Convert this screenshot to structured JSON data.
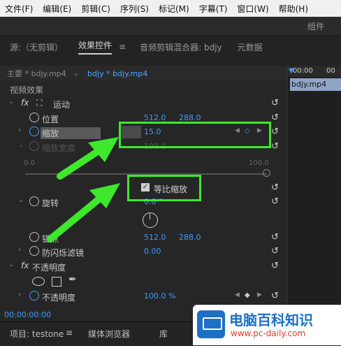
{
  "menu": [
    "文件(F)",
    "编辑(E)",
    "剪辑(C)",
    "序列(S)",
    "标记(M)",
    "字幕(T)",
    "窗口(W)",
    "帮助(H)"
  ],
  "workspace_label": "组件",
  "panel_tabs": {
    "source": "源:（无剪辑）",
    "effect_controls": "效果控件",
    "audio_mixer": "音频剪辑混合器: bdjy",
    "metadata": "元数据"
  },
  "source_bar": {
    "main": "主要 * bdjy.mp4",
    "sequence": "bdjy * bdjy.mp4"
  },
  "timeline": {
    "time": "00:00",
    "time2": "00",
    "clip": "bdjy.mp4"
  },
  "section_video": "视频效果",
  "motion": {
    "label": "运动",
    "position": {
      "label": "位置",
      "x": "512.0",
      "y": "288.0"
    },
    "scale": {
      "label": "缩放",
      "value": "15.0"
    },
    "scale_width": {
      "label": "缩放宽度",
      "value": "100.0"
    },
    "slider_min": "0.0",
    "slider_max": "100.0",
    "uniform_scale": "等比缩放",
    "rotation": {
      "label": "旋转",
      "value": "0.0 °"
    },
    "anchor": {
      "label": "锚点",
      "x": "512.0",
      "y": "288.0"
    },
    "anti_flicker": {
      "label": "防闪烁滤镜",
      "value": "0.00"
    }
  },
  "opacity": {
    "label": "不透明度",
    "value_label": "不透明度",
    "value": "100.0 %"
  },
  "timecode": "00:00:00:00",
  "bottom_tabs": {
    "project": "项目: testone",
    "media_browser": "媒体浏览器",
    "library": "库"
  },
  "watermark": {
    "title": "电脑百科知识",
    "url": "www.pc-daily.com"
  },
  "colors": {
    "accent_blue": "#3d9bff",
    "callout_green": "#3ee82c"
  }
}
